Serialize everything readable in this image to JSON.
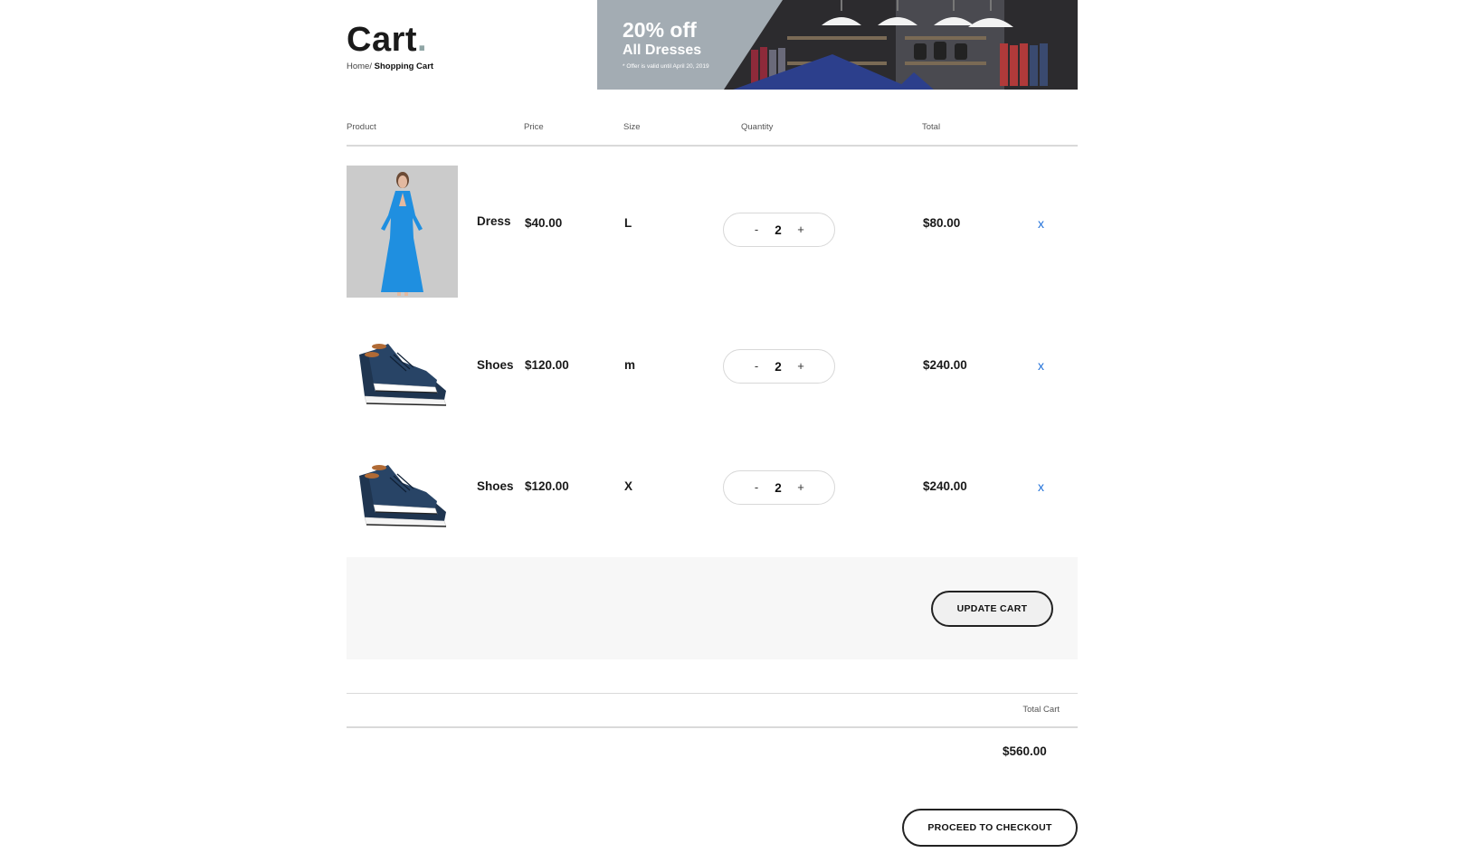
{
  "header": {
    "title": "Cart",
    "title_dot": ".",
    "breadcrumb": {
      "home": "Home/",
      "current": "Shopping Cart"
    }
  },
  "banner": {
    "headline": "20% off",
    "subheadline": "All Dresses",
    "note": "* Offer is valid until April 20, 2019"
  },
  "table": {
    "columns": [
      "Product",
      "Price",
      "Size",
      "Quantity",
      "Total"
    ]
  },
  "items": [
    {
      "name": "Dress",
      "price": "$40.00",
      "size": "L",
      "quantity": "2",
      "total": "$80.00",
      "remove": "x",
      "image": "dress-photo"
    },
    {
      "name": "Shoes",
      "price": "$120.00",
      "size": "m",
      "quantity": "2",
      "total": "$240.00",
      "remove": "x",
      "image": "sneakers-photo"
    },
    {
      "name": "Shoes",
      "price": "$120.00",
      "size": "X",
      "quantity": "2",
      "total": "$240.00",
      "remove": "x",
      "image": "sneakers-photo"
    }
  ],
  "qty_controls": {
    "minus": "-",
    "plus": "+"
  },
  "actions": {
    "update_cart": "UPDATE CART"
  },
  "totals": {
    "label": "Total Cart",
    "value": "$560.00"
  },
  "checkout": {
    "label": "PROCEED TO CHECKOUT"
  },
  "colors": {
    "accent_dot": "#8fa5a5",
    "remove_link": "#1e6fd9",
    "banner_panel": "#a3acb3",
    "dress_blue": "#1f8fe0"
  }
}
